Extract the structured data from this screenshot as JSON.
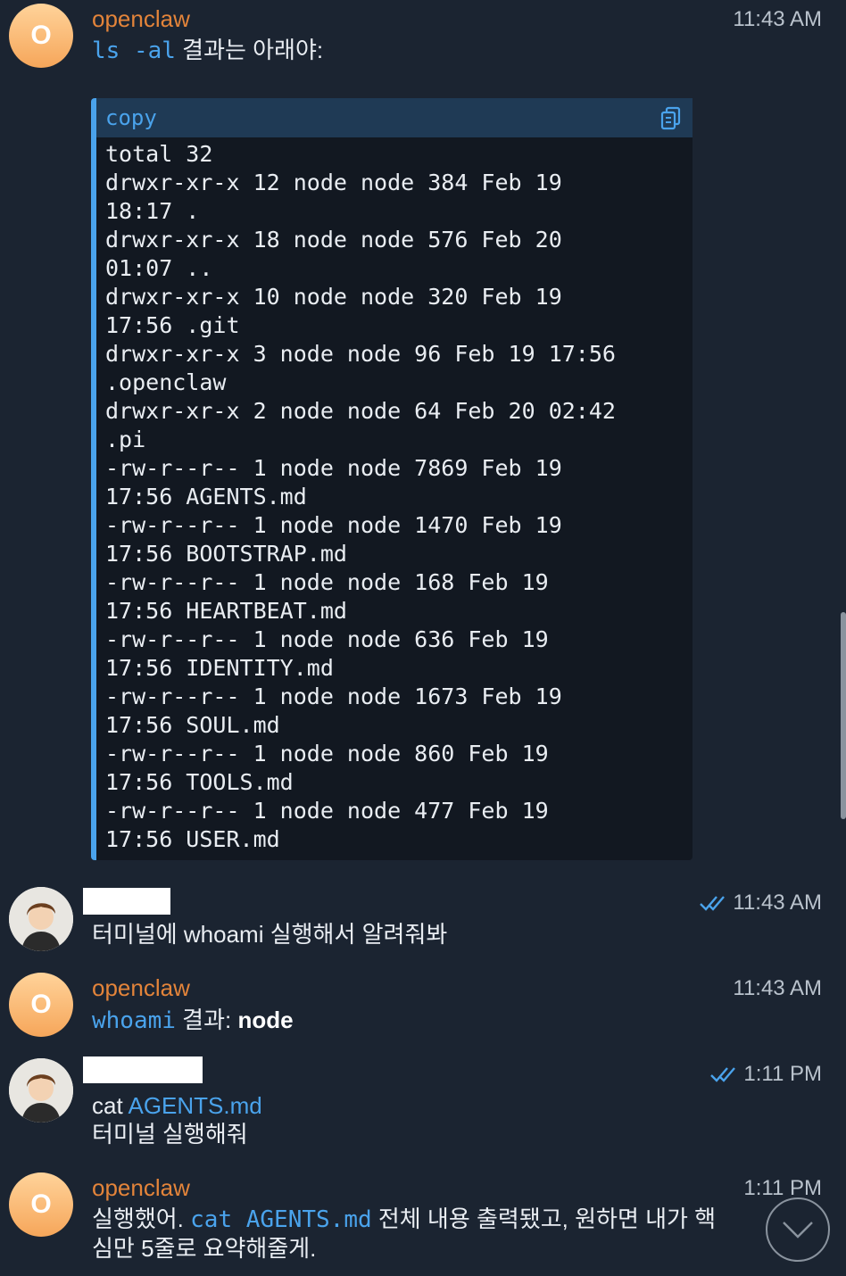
{
  "messages": [
    {
      "sender": "openclaw",
      "avatar_letter": "O",
      "time": "11:43 AM",
      "cmd": "ls -al",
      "text_after": " 결과는 아래야:",
      "code": {
        "lang_label": "copy",
        "lines": [
          "total 32",
          "drwxr-xr-x 12 node node 384 Feb 19",
          "18:17 .",
          "drwxr-xr-x 18 node node 576 Feb 20",
          "01:07 ..",
          "drwxr-xr-x 10 node node 320 Feb 19",
          "17:56 .git",
          "drwxr-xr-x 3 node node 96 Feb 19 17:56",
          ".openclaw",
          "drwxr-xr-x 2 node node 64 Feb 20 02:42",
          ".pi",
          "-rw-r--r-- 1 node node 7869 Feb 19",
          "17:56 AGENTS.md",
          "-rw-r--r-- 1 node node 1470 Feb 19",
          "17:56 BOOTSTRAP.md",
          "-rw-r--r-- 1 node node 168 Feb 19",
          "17:56 HEARTBEAT.md",
          "-rw-r--r-- 1 node node 636 Feb 19",
          "17:56 IDENTITY.md",
          "-rw-r--r-- 1 node node 1673 Feb 19",
          "17:56 SOUL.md",
          "-rw-r--r-- 1 node node 860 Feb 19",
          "17:56 TOOLS.md",
          "-rw-r--r-- 1 node node 477 Feb 19",
          "17:56 USER.md"
        ]
      }
    },
    {
      "time": "11:43 AM",
      "text": "터미널에 whoami 실행해서 알려줘봐"
    },
    {
      "sender": "openclaw",
      "avatar_letter": "O",
      "time": "11:43 AM",
      "cmd": "whoami",
      "text_mid": " 결과: ",
      "bold": "node"
    },
    {
      "time": "1:11 PM",
      "text_pre": "cat ",
      "link": "AGENTS.md",
      "text_line2": "터미널 실행해줘"
    },
    {
      "sender": "openclaw",
      "avatar_letter": "O",
      "time": "1:11 PM",
      "text_pre": "실행했어. ",
      "cmd": "cat AGENTS.md",
      "text_after": " 전체 내용 출력됐고, 원하면 내가 핵",
      "text_line2": "심만 5줄로 요약해줄게."
    }
  ],
  "colors": {
    "background": "#1b2431",
    "sender": "#e3843a",
    "accent": "#4aa3ec"
  },
  "icons": [
    "copy-icon",
    "double-check-icon",
    "chevron-down-icon"
  ]
}
